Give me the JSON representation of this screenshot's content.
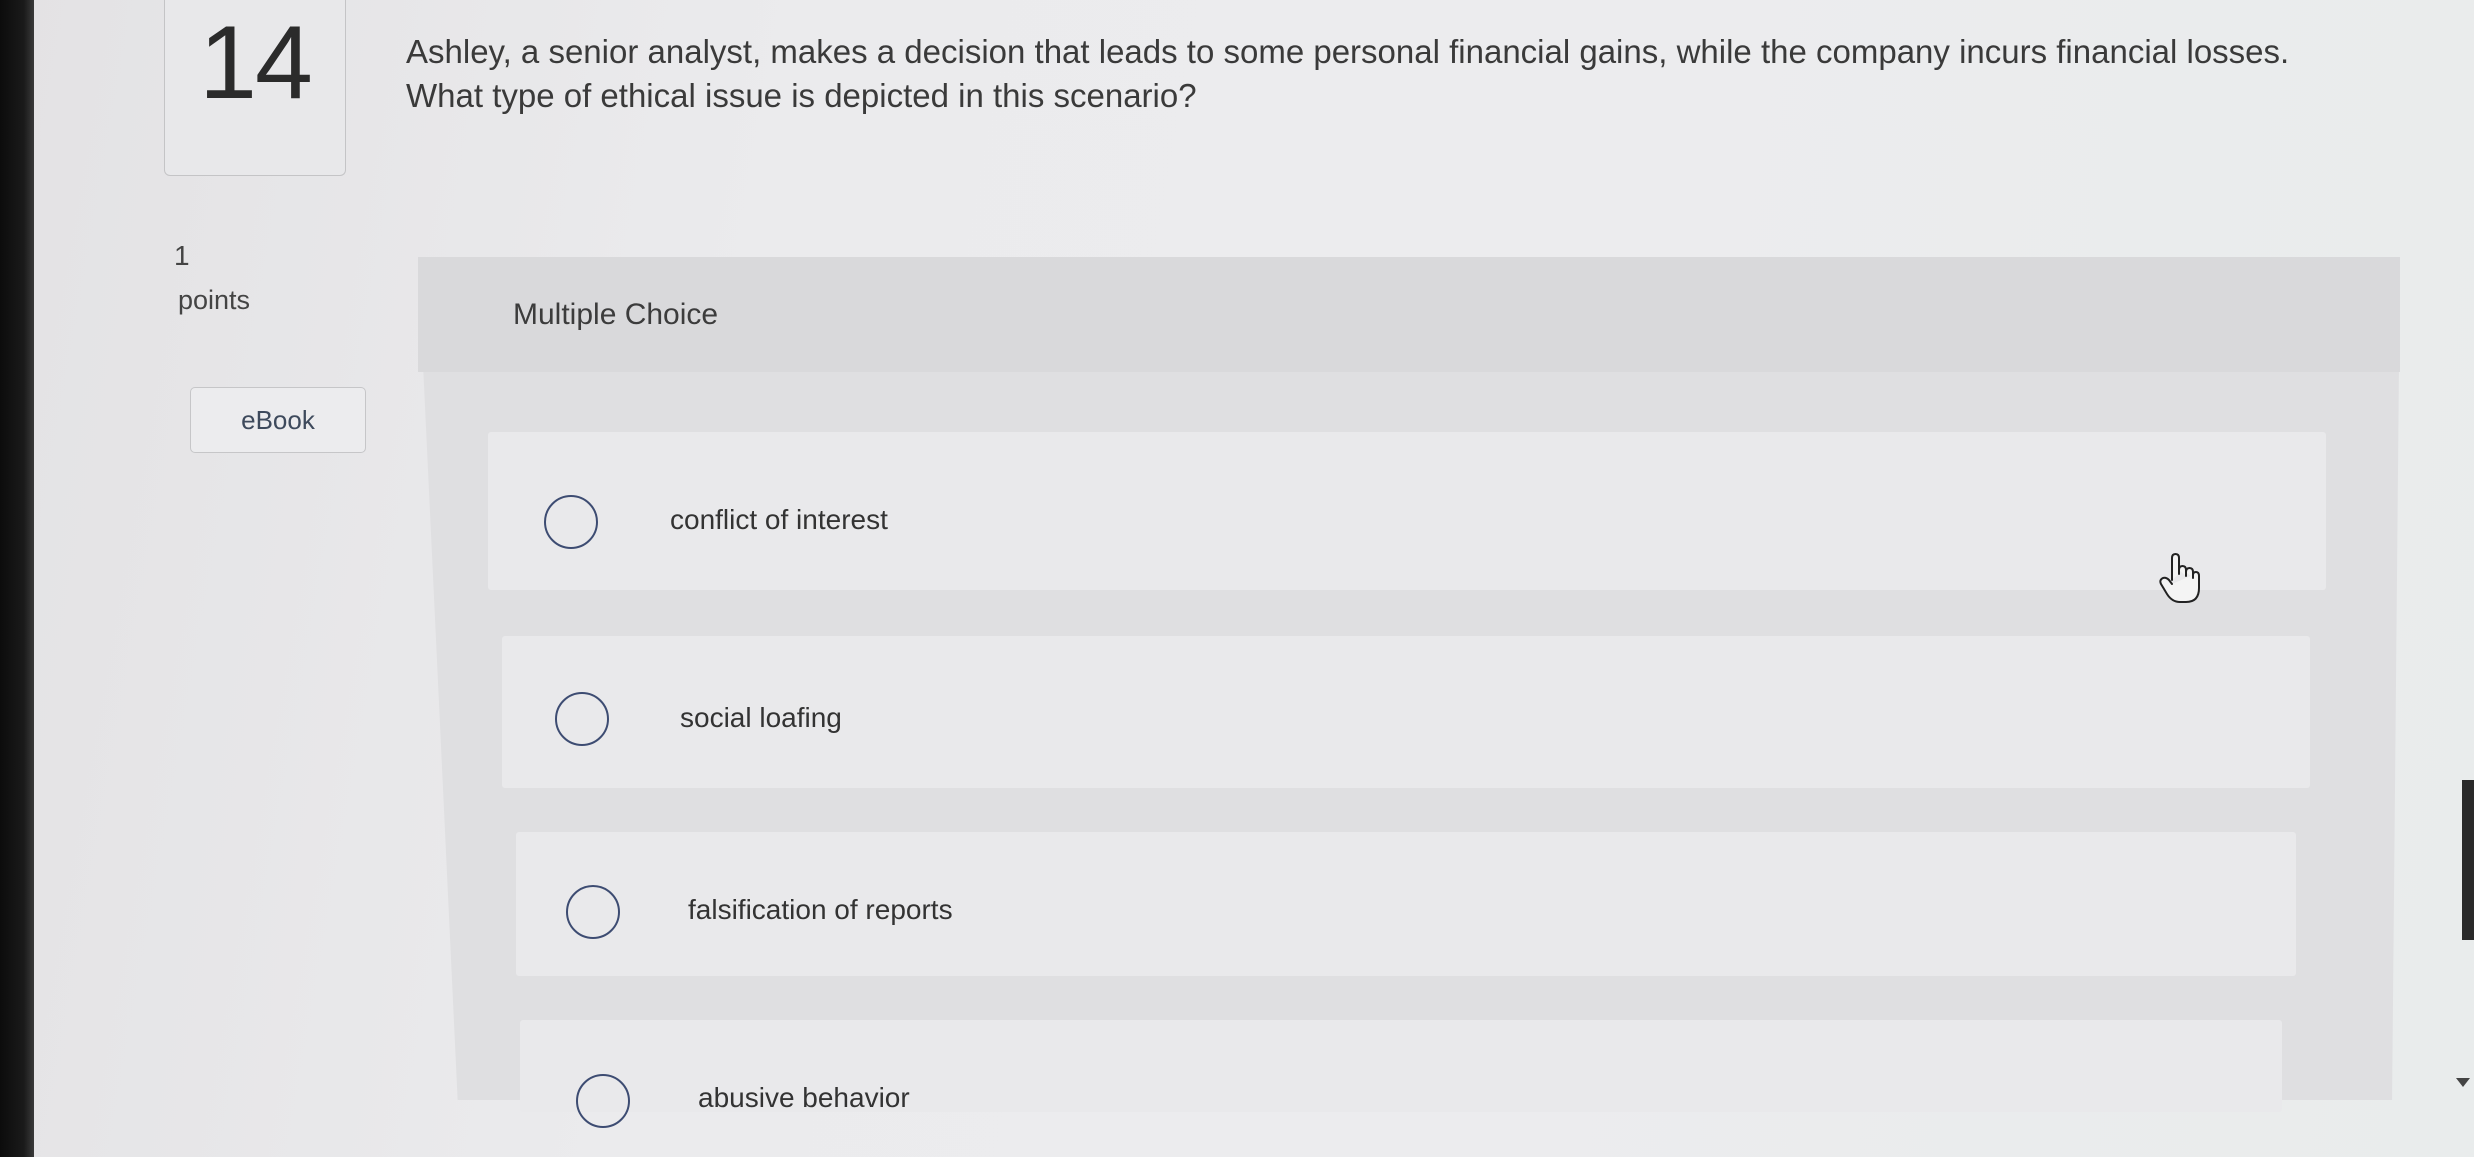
{
  "question": {
    "number": "14",
    "text_line1": "Ashley, a senior analyst, makes a decision that leads to some personal financial gains, while the company incurs financial losses.",
    "text_line2": "What type of ethical issue is depicted in this scenario?"
  },
  "points": {
    "value": "1",
    "label": "points"
  },
  "ebook": {
    "label": "eBook"
  },
  "answer": {
    "type_label": "Multiple Choice",
    "options": [
      {
        "label": "conflict of interest"
      },
      {
        "label": "social loafing"
      },
      {
        "label": "falsification of reports"
      },
      {
        "label": "abusive behavior"
      }
    ]
  },
  "colors": {
    "radio_border": "#3d4c72",
    "ebook_text": "#3e4a5c"
  },
  "icons": [
    "hand-cursor-icon",
    "scroll-down-arrow-icon"
  ]
}
